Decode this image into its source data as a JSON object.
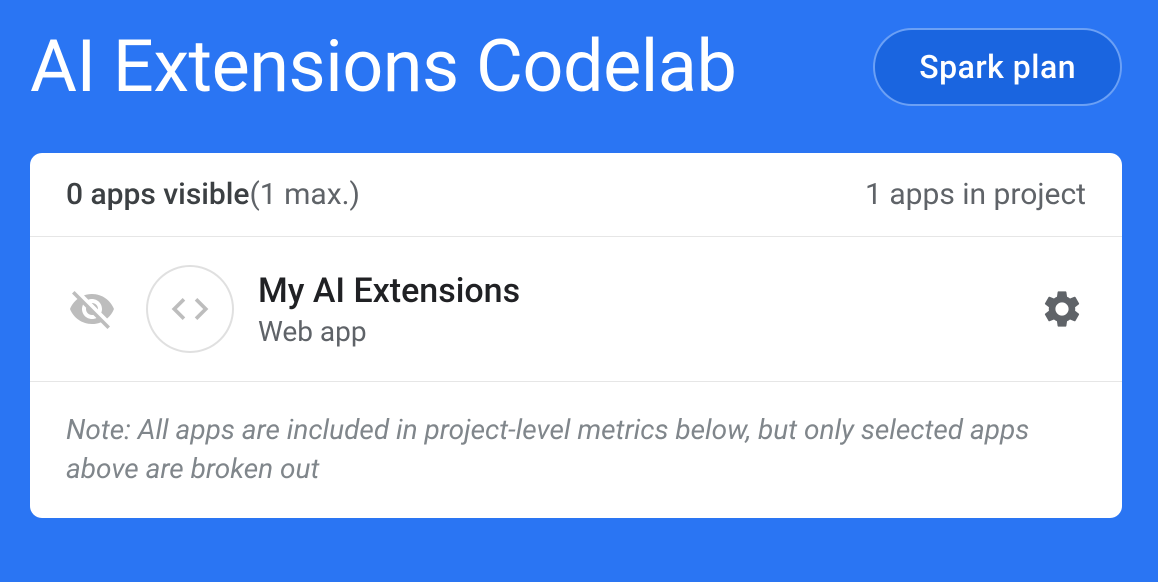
{
  "header": {
    "title": "AI Extensions Codelab",
    "plan_button": "Spark plan"
  },
  "card": {
    "visible_count": "0 apps visible",
    "visible_max": "(1 max.)",
    "apps_in_project": "1 apps in project",
    "app": {
      "name": "My AI Extensions",
      "type": "Web app"
    },
    "note": "Note: All apps are included in project-level metrics below, but only selected apps above are broken out"
  },
  "colors": {
    "background": "#2a75f3",
    "card_bg": "#ffffff",
    "text_primary": "#202124",
    "text_secondary": "#5f6368",
    "icon_muted": "#bdbdbd"
  }
}
